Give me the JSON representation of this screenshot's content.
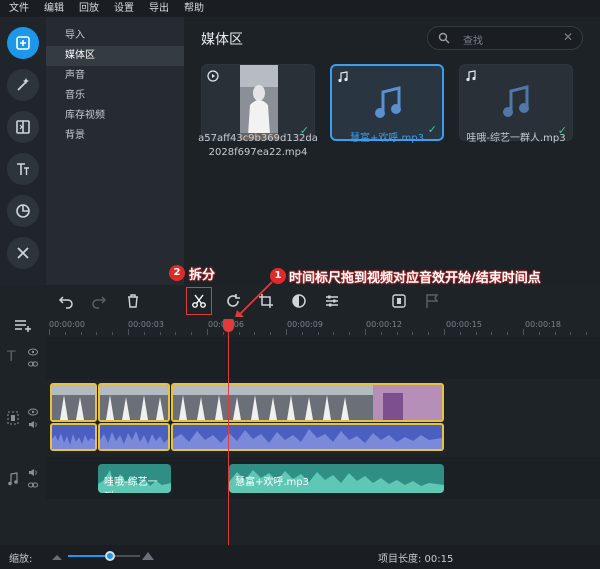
{
  "menu": [
    "文件",
    "编辑",
    "回放",
    "设置",
    "导出",
    "帮助"
  ],
  "rail_tools": [
    {
      "name": "import-icon",
      "active": true
    },
    {
      "name": "magic-wand-icon",
      "active": false
    },
    {
      "name": "transition-icon",
      "active": false
    },
    {
      "name": "text-icon",
      "active": false
    },
    {
      "name": "sticker-icon",
      "active": false
    },
    {
      "name": "tools-icon",
      "active": false
    }
  ],
  "categories": [
    "导入",
    "媒体区",
    "声音",
    "音乐",
    "库存视频",
    "背景"
  ],
  "selected_category": "媒体区",
  "library": {
    "title": "媒体区",
    "search_placeholder": "查找",
    "items": [
      {
        "name": "a57aff43c9b369d132da2028f697ea22.mp4",
        "type": "video"
      },
      {
        "name": "慧富+欢呼.mp3",
        "type": "audio",
        "selected": true
      },
      {
        "name": "哇哦-综艺一群人.mp3",
        "type": "audio"
      }
    ]
  },
  "annotations": {
    "step1": {
      "num": "1",
      "text": "时间标尺拖到视频对应音效开始/结束时间点"
    },
    "step2": {
      "num": "2",
      "text": "拆分"
    }
  },
  "ruler_ticks": [
    "00:00:00",
    "00:00:03",
    "00:00:06",
    "00:00:09",
    "00:00:12",
    "00:00:15",
    "00:00:18"
  ],
  "music_clips": [
    {
      "label": "哇哦-综艺一群..."
    },
    {
      "label": "慧富+欢呼.mp3"
    }
  ],
  "bottom": {
    "zoom_label": "缩放:",
    "duration_label": "项目长度: 00:15"
  },
  "colors": {
    "accent": "#1c97ea",
    "clip_border": "#e8c23a",
    "playhead": "#e03b3b",
    "music": "#2f8f84"
  }
}
